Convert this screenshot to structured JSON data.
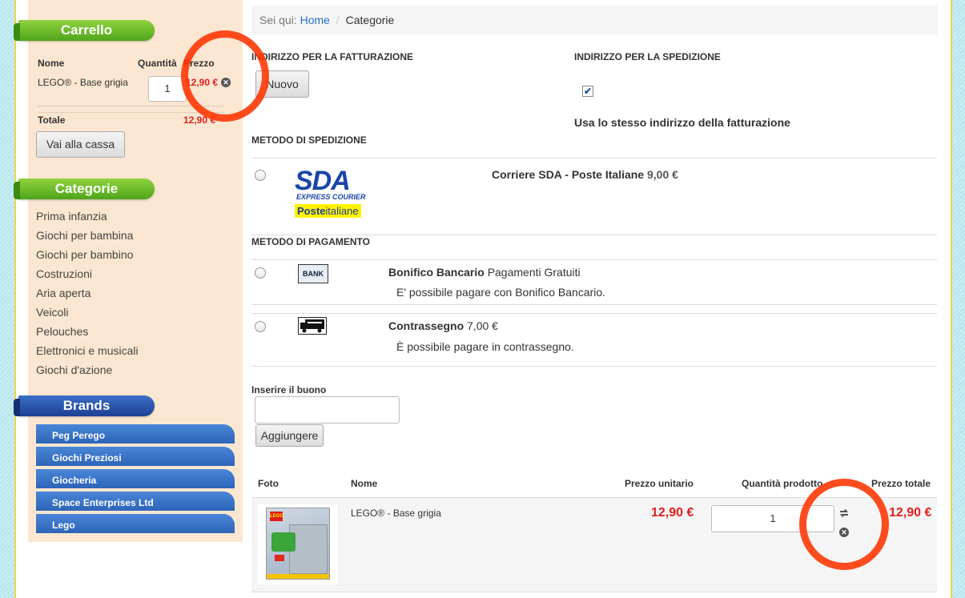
{
  "sidebar": {
    "cart": {
      "title": "Carrello",
      "col_name": "Nome",
      "col_qty": "Quantità",
      "col_price": "Prezzo",
      "item_name": "LEGO® - Base grigia",
      "item_qty": "1",
      "item_price": "12,90 €",
      "total_label": "Totale",
      "total_value": "12,90 €",
      "checkout_label": "Vai alla cassa"
    },
    "categories": {
      "title": "Categorie",
      "items": [
        "Prima infanzia",
        "Giochi per bambina",
        "Giochi per bambino",
        "Costruzioni",
        "Aria aperta",
        "Veicoli",
        "Pelouches",
        "Elettronici e musicali",
        "Giochi d'azione"
      ]
    },
    "brands": {
      "title": "Brands",
      "items": [
        "Peg Perego",
        "Giochi Preziosi",
        "Giocheria",
        "Space Enterprises Ltd",
        "Lego"
      ]
    }
  },
  "breadcrumb": {
    "prefix": "Sei qui:",
    "home": "Home",
    "separator": "/",
    "current": "Categorie"
  },
  "billing": {
    "title": "INDIRIZZO PER LA FATTURAZIONE",
    "new_button": "Nuovo"
  },
  "shipping_address": {
    "title": "INDIRIZZO PER LA SPEDIZIONE",
    "checkbox_checked": true,
    "same_label": "Usa lo stesso indirizzo della fatturazione"
  },
  "shipping_method": {
    "title": "METODO DI SPEDIZIONE",
    "option_name": "Corriere SDA - Poste Italiane",
    "option_price": "9,00 €",
    "logo_main": "SDA",
    "logo_sub": "EXPRESS COURIER",
    "logo_poste_bold": "Poste",
    "logo_poste_normal": "italiane"
  },
  "payment_method": {
    "title": "METODO DI PAGAMENTO",
    "options": [
      {
        "name": "Bonifico Bancario",
        "extra": "Pagamenti Gratuiti",
        "desc": "E' possibile pagare con Bonifico Bancario.",
        "icon_text": "BANK"
      },
      {
        "name": "Contrassegno",
        "extra": "7,00 €",
        "desc": "È possibile pagare in contrassegno."
      }
    ]
  },
  "coupon": {
    "label": "Inserire il buono",
    "value": "",
    "button": "Aggiungere"
  },
  "product_table": {
    "headers": [
      "Foto",
      "Nome",
      "Prezzo unitario",
      "Quantità prodotto",
      "Prezzo totale"
    ],
    "row": {
      "name": "LEGO® - Base grigia",
      "unit_price": "12,90 €",
      "qty": "1",
      "total_price": "12,90 €",
      "box_logo": "LEGO"
    }
  },
  "colors": {
    "price_red": "#e41e1e",
    "ribbon_green": "#4fa51b",
    "ribbon_blue": "#1d3f93",
    "brand_blue": "#2d64b8",
    "link_blue": "#2a6fc9",
    "annotation": "#ff3300"
  }
}
